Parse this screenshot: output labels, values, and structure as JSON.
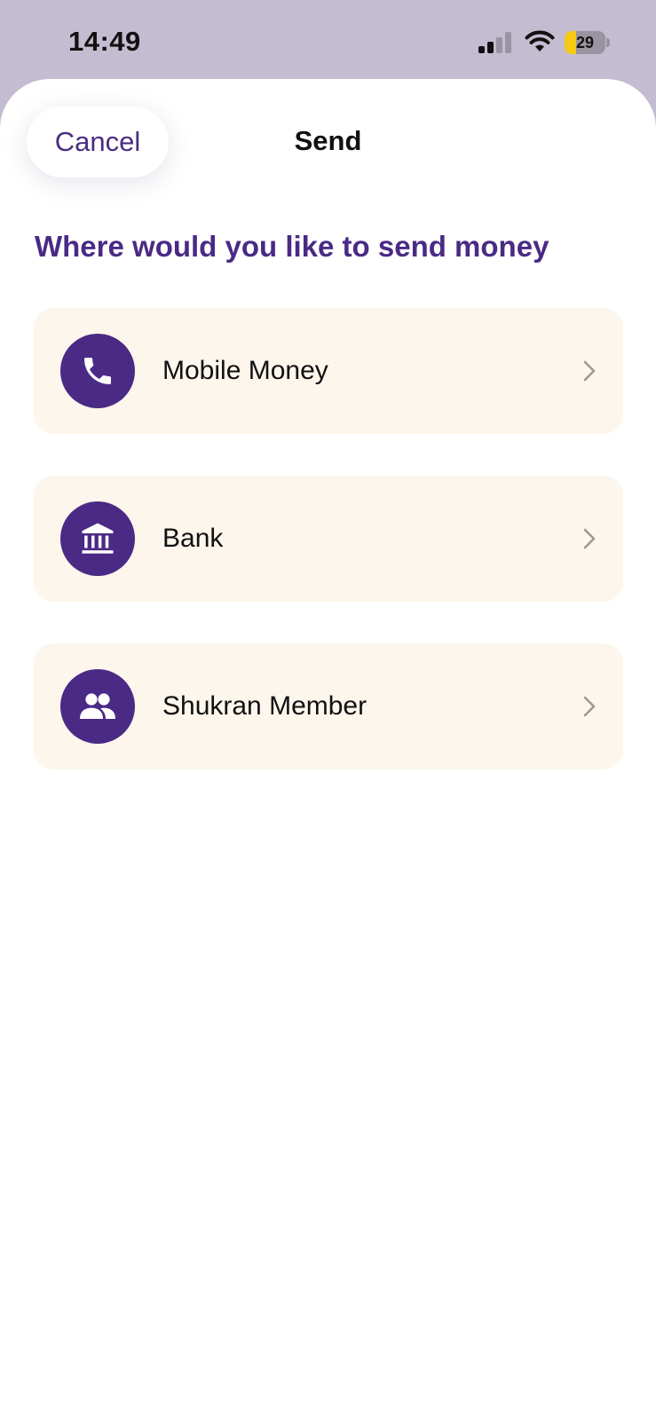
{
  "status_bar": {
    "time": "14:49",
    "battery_level": "29",
    "battery_fraction": 0.29,
    "signal_icon": "cellular-signal-icon",
    "wifi_icon": "wifi-icon"
  },
  "sheet": {
    "cancel_label": "Cancel",
    "title": "Send"
  },
  "prompt": "Where would you like to send money",
  "options": [
    {
      "label": "Mobile Money",
      "icon": "phone-icon"
    },
    {
      "label": "Bank",
      "icon": "bank-icon"
    },
    {
      "label": "Shukran Member",
      "icon": "people-icon"
    }
  ],
  "colors": {
    "brand_purple": "#4a2a85",
    "card_background": "#fcf6ec",
    "battery_yellow": "#f6c915"
  }
}
